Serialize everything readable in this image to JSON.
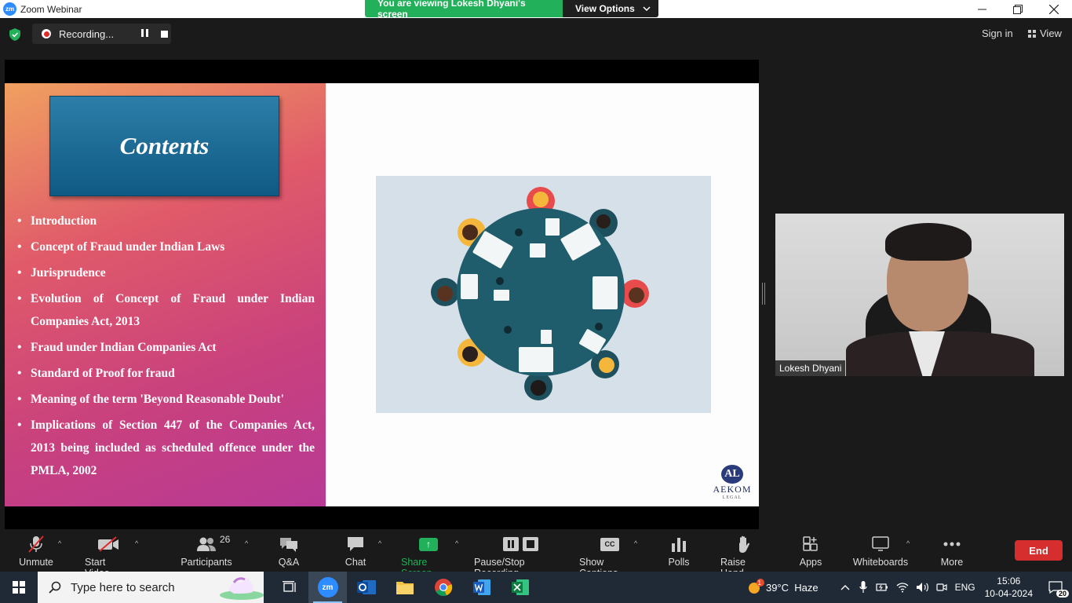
{
  "window": {
    "app_logo": "zm",
    "title": "Zoom Webinar",
    "viewing_banner": "You are viewing Lokesh Dhyani's screen",
    "view_options": "View Options"
  },
  "status": {
    "recording_label": "Recording...",
    "sign_in": "Sign in",
    "view": "View"
  },
  "slide": {
    "title": "Contents",
    "items": [
      "Introduction",
      "Concept of Fraud under Indian Laws",
      "Jurisprudence",
      "Evolution of Concept of Fraud under Indian Companies Act, 2013",
      "Fraud under Indian Companies Act",
      "Standard of Proof for fraud",
      "Meaning of the term 'Beyond Reasonable Doubt'",
      "Implications of Section 447 of the Companies Act, 2013 being included as scheduled offence under the PMLA, 2002"
    ],
    "logo_mark": "AL",
    "logo_name": "AEKOM",
    "logo_sub": "LEGAL"
  },
  "video": {
    "participant_name": "Lokesh Dhyani"
  },
  "toolbar": {
    "unmute": "Unmute",
    "start_video": "Start Video",
    "participants": "Participants",
    "participants_count": "26",
    "qa": "Q&A",
    "chat": "Chat",
    "share_screen": "Share Screen",
    "pause_stop_recording": "Pause/Stop Recording",
    "show_captions": "Show Captions",
    "captions_icon_text": "CC",
    "polls": "Polls",
    "raise_hand": "Raise Hand",
    "apps": "Apps",
    "whiteboards": "Whiteboards",
    "more": "More",
    "end": "End"
  },
  "taskbar": {
    "search_placeholder": "Type here to search",
    "weather": "39°C  Haze",
    "weather_badge": "1",
    "language": "ENG",
    "time": "15:06",
    "date": "10-04-2024",
    "notifications": "20",
    "zoom_icon_text": "zm"
  },
  "colors": {
    "zoom_blue": "#2d8cff",
    "banner_green": "#23b05a",
    "end_red": "#d62e2e",
    "slide_title_blue": "#0f5a84"
  }
}
